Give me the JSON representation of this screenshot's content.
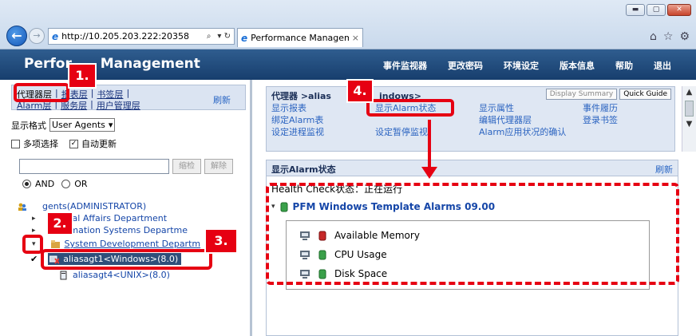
{
  "browser": {
    "url": "http://10.205.203.222:20358",
    "address_controls": "▾ ↻",
    "tab_title": "Performance Managem...",
    "tab_close": "×",
    "win_minimize": "▬",
    "win_maximize": "▢",
    "win_close": "✕",
    "back_glyph": "←",
    "fwd_glyph": "→",
    "ie_glyph": "e",
    "home_glyph": "⌂",
    "star_glyph": "☆",
    "gear_glyph": "⚙",
    "search_glyph": "⌕"
  },
  "app": {
    "title_part1": "Perfor",
    "title_part2": " Management",
    "menu": [
      "事件监视器",
      "更改密码",
      "环境设定",
      "版本信息",
      "帮助",
      "退出"
    ]
  },
  "left_nav": {
    "row1": [
      "代理器层",
      "报表层",
      "书签层"
    ],
    "row2": [
      "Alarm层",
      "服务层",
      "用户管理层"
    ],
    "separator": "|",
    "refresh": "刷新"
  },
  "display_format": {
    "label": "显示格式",
    "value": "User Agents",
    "arrow": "▾"
  },
  "options": {
    "multi_select_label": "多项选择",
    "multi_select_checked": false,
    "auto_update_label": "自动更新",
    "auto_update_checked": true,
    "check_glyph": "✓"
  },
  "search": {
    "value": "",
    "filter_btn": "缩检",
    "clear_btn": "解除",
    "radio_and": "AND",
    "radio_or": "OR"
  },
  "tree": {
    "root": "gents(ADMINISTRATOR)",
    "node1": "eneral Affairs Department",
    "node2": "nformation Systems Departme",
    "node3": "System Development Departm",
    "agent1": "aliasagt1<Windows>(8.0)",
    "agent2": "aliasagt4<UNIX>(8.0)",
    "tri_right": "▸",
    "tri_down": "▾",
    "check": "✔"
  },
  "crumb": {
    "title_left": "代理器 >alias",
    "title_right": "indows>",
    "display_summary": "Display Summary",
    "quick_guide": "Quick Guide",
    "scroll_up": "▲",
    "scroll_down": "▼",
    "links": [
      [
        "显示报表",
        "显示Alarm状态",
        "显示属性",
        "事件履历"
      ],
      [
        "绑定Alarm表",
        "",
        "编辑代理器层",
        "登录书签"
      ],
      [
        "设定进程监视",
        "设定暂停监视",
        "Alarm应用状况的确认",
        ""
      ]
    ]
  },
  "panel": {
    "title": "显示Alarm状态",
    "refresh": "刷新",
    "health_label": "Health Check状态：正在运行",
    "alarm_table": "PFM Windows Template Alarms 09.00",
    "alarms": [
      "Available Memory",
      "CPU Usage",
      "Disk Space"
    ],
    "alarm_colors": [
      "#c62828",
      "#3aa04a",
      "#3aa04a"
    ]
  },
  "callouts": [
    "1.",
    "2.",
    "3.",
    "4."
  ],
  "colors": {
    "annotation": "#e60012",
    "header": "#1f4a7e",
    "link": "#2a63c0"
  }
}
